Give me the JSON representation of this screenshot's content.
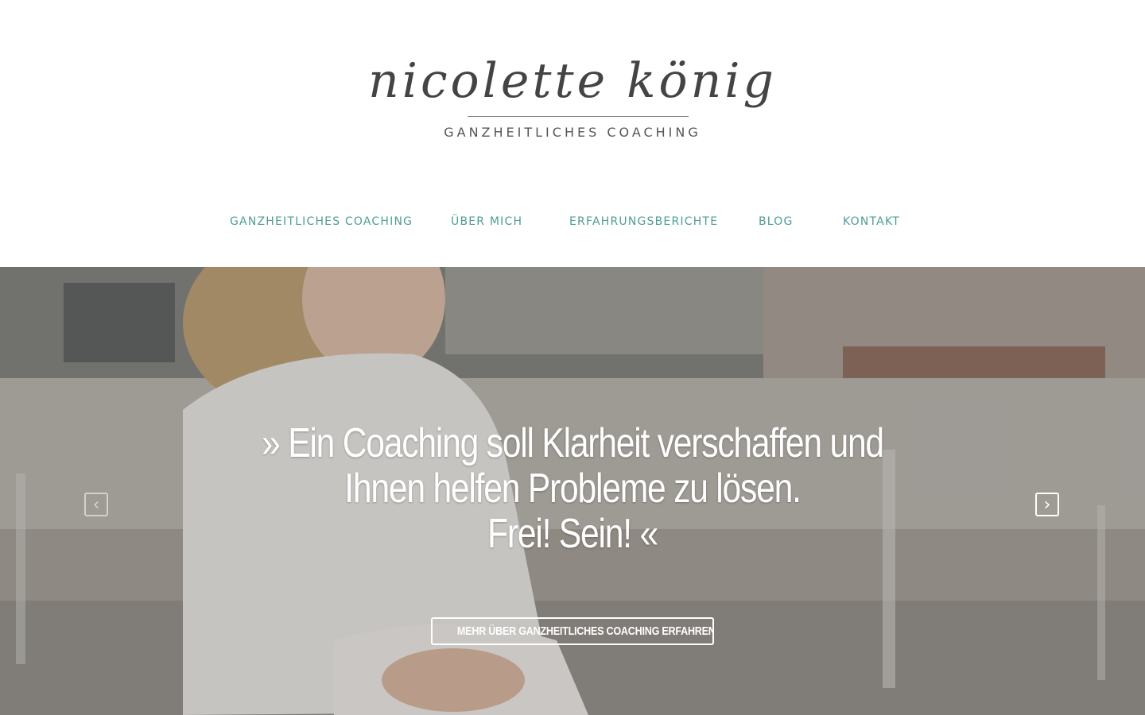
{
  "brand": {
    "script_name": "nicolette könig",
    "tagline": "GANZHEITLICHES COACHING"
  },
  "nav": {
    "items": [
      {
        "label": "GANZHEITLICHES COACHING"
      },
      {
        "label": "ÜBER MICH"
      },
      {
        "label": "ERFAHRUNGSBERICHTE"
      },
      {
        "label": "BLOG"
      },
      {
        "label": "KONTAKT"
      }
    ]
  },
  "hero": {
    "quote_lines": [
      "» Ein Coaching soll Klarheit verschaffen und",
      "Ihnen helfen Probleme zu lösen.",
      "Frei! Sein! «"
    ],
    "prev_icon": "chevron-left-icon",
    "next_icon": "chevron-right-icon",
    "prev_glyph": "‹",
    "next_glyph": "›",
    "cta_label": "MEHR ÜBER GANZHEITLICHES COACHING ERFAHREN"
  },
  "colors": {
    "nav_text": "#4f9c96",
    "logo_text": "#444444",
    "hero_text": "#ffffff"
  }
}
